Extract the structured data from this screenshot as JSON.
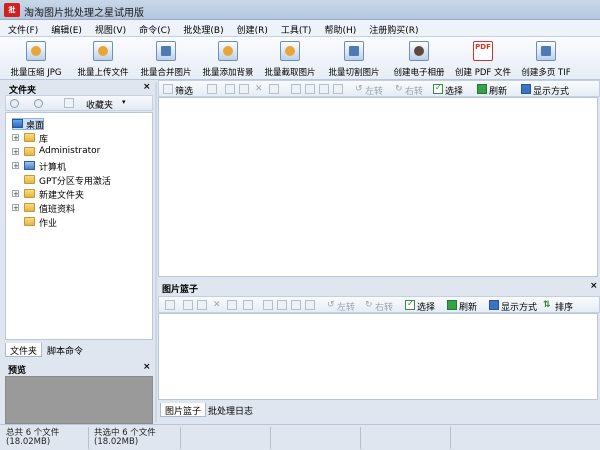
{
  "window": {
    "app_icon_text": "批",
    "title": "淘淘图片批处理之星试用版"
  },
  "menu": [
    "文件(F)",
    "编辑(E)",
    "视图(V)",
    "命令(C)",
    "批处理(B)",
    "创建(R)",
    "工具(T)",
    "帮助(H)",
    "注册购买(R)"
  ],
  "big_toolbar": [
    {
      "label": "批量压缩 JPG",
      "icon": "compress-jpg-icon"
    },
    {
      "label": "批量上传文件",
      "icon": "upload-icon"
    },
    {
      "label": "批量合并图片",
      "icon": "merge-images-icon"
    },
    {
      "label": "批量添加背景",
      "icon": "add-background-icon"
    },
    {
      "label": "批量截取图片",
      "icon": "crop-icon"
    },
    {
      "label": "批量切割图片",
      "icon": "slice-icon"
    },
    {
      "label": "创建电子相册",
      "icon": "ealbum-icon"
    },
    {
      "label": "创建 PDF 文件",
      "icon": "pdf-icon",
      "icon_text": "PDF"
    },
    {
      "label": "创建多页 TIF",
      "icon": "tif-icon"
    }
  ],
  "folder_panel": {
    "title": "文件夹",
    "close": "×",
    "favorites": "收藏夹",
    "tree": [
      {
        "label": "桌面",
        "icon": "desktop-icon",
        "expander": "",
        "level": 0
      },
      {
        "label": "库",
        "icon": "folder-icon",
        "expander": "+",
        "level": 1
      },
      {
        "label": "Administrator",
        "icon": "folder-icon",
        "expander": "+",
        "level": 1
      },
      {
        "label": "计算机",
        "icon": "computer-icon",
        "expander": "+",
        "level": 1
      },
      {
        "label": "GPT分区专用激活",
        "icon": "folder-icon",
        "expander": "",
        "level": 1
      },
      {
        "label": "新建文件夹",
        "icon": "folder-icon",
        "expander": "+",
        "level": 1
      },
      {
        "label": "值班资料",
        "icon": "folder-icon",
        "expander": "+",
        "level": 1
      },
      {
        "label": "作业",
        "icon": "folder-icon",
        "expander": "",
        "level": 1
      }
    ],
    "tabs": [
      "文件夹",
      "脚本命令"
    ]
  },
  "preview_panel": {
    "title": "预览",
    "close": "×"
  },
  "main_toolbar": {
    "filter": "筛选",
    "rotate_left": "左转",
    "rotate_right": "右转",
    "select": "选择",
    "refresh": "刷新",
    "display_mode": "显示方式"
  },
  "basket": {
    "title": "图片篮子",
    "close": "×",
    "toolbar": {
      "rotate_left": "左转",
      "rotate_right": "右转",
      "select": "选择",
      "refresh": "刷新",
      "display_mode": "显示方式",
      "sort": "排序"
    },
    "tabs": [
      "图片篮子",
      "批处理日志"
    ]
  },
  "status": {
    "total_line1": "总共 6 个文件",
    "total_line2": "(18.02MB)",
    "selected_line1": "共选中 6 个文件",
    "selected_line2": "(18.02MB)"
  }
}
